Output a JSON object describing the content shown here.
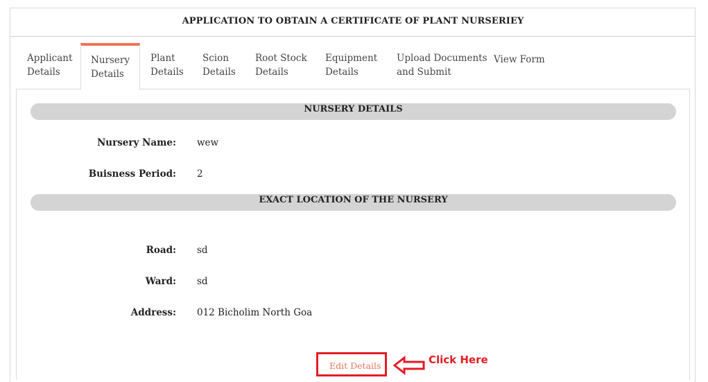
{
  "header": {
    "title": "APPLICATION TO OBTAIN A CERTIFICATE OF PLANT NURSERIEY"
  },
  "tabs": [
    {
      "line1": "Applicant",
      "line2": "Details"
    },
    {
      "line1": "Nursery",
      "line2": "Details",
      "active": true
    },
    {
      "line1": "Plant",
      "line2": "Details"
    },
    {
      "line1": "Scion",
      "line2": "Details"
    },
    {
      "line1": "Root Stock",
      "line2": "Details"
    },
    {
      "line1": "Equipment",
      "line2": "Details"
    },
    {
      "line1": "Upload Documents",
      "line2": "and Submit"
    },
    {
      "line1": "View Form",
      "line2": ""
    }
  ],
  "nursery_details": {
    "heading": "NURSERY DETAILS",
    "name_label": "Nursery Name:",
    "name_value": "wew",
    "period_label": "Buisness Period:",
    "period_value": "2"
  },
  "location": {
    "heading": "EXACT LOCATION OF THE NURSERY",
    "road_label": "Road:",
    "road_value": "sd",
    "ward_label": "Ward:",
    "ward_value": "sd",
    "address_label": "Address:",
    "address_value": "012 Bicholim North Goa"
  },
  "actions": {
    "edit_label": "Edit Details",
    "annotation": "Click Here"
  },
  "colors": {
    "active_tab_accent": "#f07254",
    "annotation_red": "#e31d25",
    "link": "#e8735c",
    "section_bar": "#d4d4d4"
  }
}
